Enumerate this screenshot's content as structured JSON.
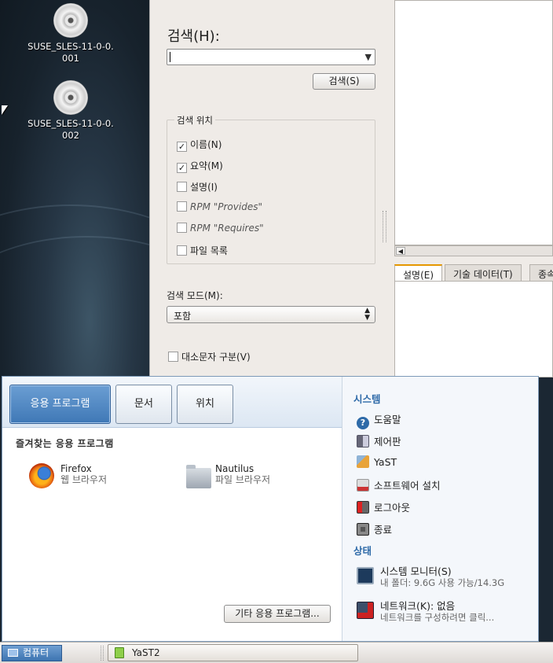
{
  "desktop": {
    "icons": [
      {
        "label_line1": "SUSE_SLES-11-0-0.",
        "label_line2": "001"
      },
      {
        "label_line1": "SUSE_SLES-11-0-0.",
        "label_line2": "002"
      }
    ]
  },
  "yast": {
    "search_title": "검색(H):",
    "search_value": "",
    "search_button": "검색(S)",
    "search_in_title": "검색 위치",
    "search_in": [
      {
        "label": "이름(N)",
        "checked": true
      },
      {
        "label": "요약(M)",
        "checked": true
      },
      {
        "label": "설명(I)",
        "checked": false
      },
      {
        "label": "RPM \"Provides\"",
        "checked": false
      },
      {
        "label": "RPM \"Requires\"",
        "checked": false
      },
      {
        "label": "파일 목록",
        "checked": false
      }
    ],
    "search_mode_label": "검색 모드(M):",
    "search_mode_value": "포함",
    "case_sensitive_label": "대소문자 구분(V)",
    "tabs": [
      "설명(E)",
      "기술 데이터(T)",
      "종속"
    ]
  },
  "menu": {
    "tabs": [
      "응용 프로그램",
      "문서",
      "위치"
    ],
    "favorites_title": "즐겨찾는 응용 프로그램",
    "apps": [
      {
        "name": "Firefox",
        "desc": "웹 브라우저",
        "icon": "firefox-icon"
      },
      {
        "name": "Nautilus",
        "desc": "파일 브라우저",
        "icon": "folder-icon"
      }
    ],
    "more_apps_button": "기타 응용 프로그램...",
    "system_title": "시스템",
    "system_items": [
      {
        "label": "도움말",
        "icon": "help-icon"
      },
      {
        "label": "제어판",
        "icon": "control-panel-icon"
      },
      {
        "label": "YaST",
        "icon": "yast-icon"
      },
      {
        "label": "소프트웨어 설치",
        "icon": "software-install-icon"
      },
      {
        "label": "로그아웃",
        "icon": "logout-icon"
      },
      {
        "label": "종료",
        "icon": "shutdown-icon"
      }
    ],
    "status_title": "상태",
    "monitor": {
      "label": "시스템 모니터(S)",
      "sub": "내 폴더: 9.6G 사용 가능/14.3G"
    },
    "network": {
      "label": "네트워크(K): 없음",
      "sub": "네트워크를 구성하려면 클릭..."
    }
  },
  "taskbar": {
    "start_label": "컴퓨터",
    "window_label": "YaST2"
  }
}
